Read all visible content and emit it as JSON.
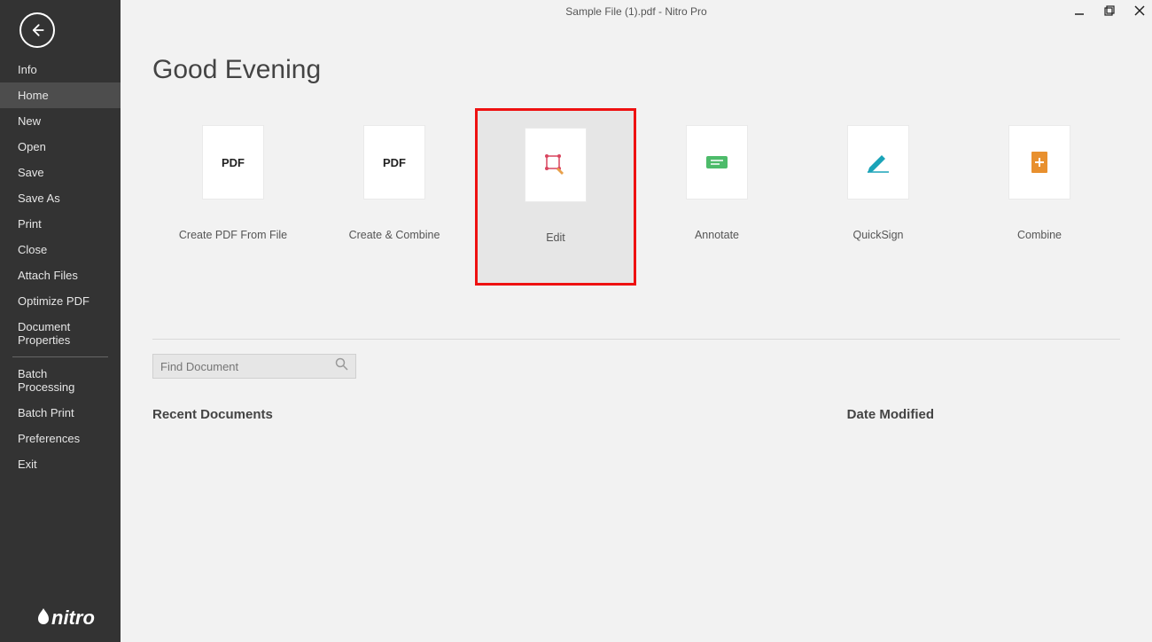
{
  "window": {
    "title": "Sample File (1).pdf - Nitro Pro"
  },
  "sidebar": {
    "items": [
      {
        "label": "Info",
        "active": false
      },
      {
        "label": "Home",
        "active": true
      },
      {
        "label": "New",
        "active": false
      },
      {
        "label": "Open",
        "active": false
      },
      {
        "label": "Save",
        "active": false
      },
      {
        "label": "Save As",
        "active": false
      },
      {
        "label": "Print",
        "active": false
      },
      {
        "label": "Close",
        "active": false
      },
      {
        "label": "Attach Files",
        "active": false
      },
      {
        "label": "Optimize PDF",
        "active": false
      },
      {
        "label": "Document Properties",
        "active": false
      }
    ],
    "items2": [
      {
        "label": "Batch Processing"
      },
      {
        "label": "Batch Print"
      },
      {
        "label": "Preferences"
      },
      {
        "label": "Exit"
      }
    ],
    "brand": "nitro"
  },
  "main": {
    "greeting": "Good Evening",
    "tiles": [
      {
        "id": "create-from-file",
        "label": "Create PDF From File",
        "icon": "pdf-text",
        "highlight": false
      },
      {
        "id": "create-combine",
        "label": "Create & Combine",
        "icon": "pdf-text",
        "highlight": false
      },
      {
        "id": "edit",
        "label": "Edit",
        "icon": "edit",
        "highlight": true
      },
      {
        "id": "annotate",
        "label": "Annotate",
        "icon": "annotate",
        "highlight": false
      },
      {
        "id": "quicksign",
        "label": "QuickSign",
        "icon": "sign",
        "highlight": false
      },
      {
        "id": "combine",
        "label": "Combine",
        "icon": "combine",
        "highlight": false
      }
    ],
    "pdf_word": "PDF",
    "search_placeholder": "Find Document",
    "recent_header": "Recent Documents",
    "date_header": "Date Modified"
  }
}
